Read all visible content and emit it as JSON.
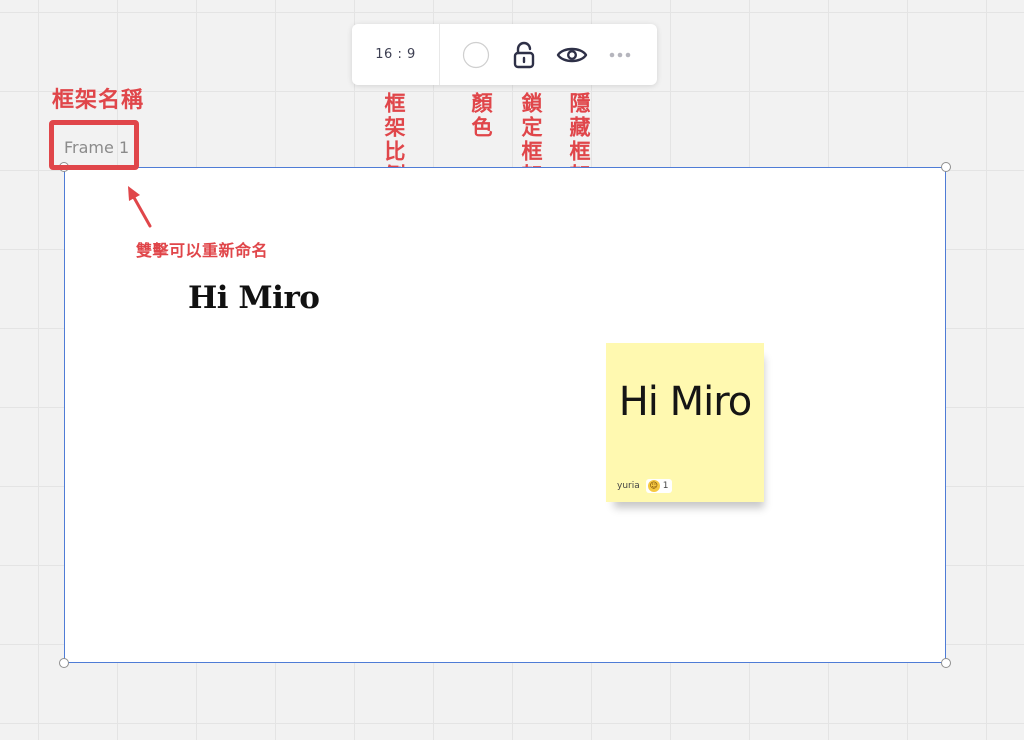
{
  "toolbar": {
    "aspect_ratio": "16 : 9",
    "icons": [
      "color-circle-icon",
      "unlock-icon",
      "eye-icon",
      "more-icon"
    ]
  },
  "annotations": {
    "frame_name": "框架名稱",
    "rename_hint": "雙擊可以重新命名",
    "frame_ratio": "框架比例",
    "color": "顏色",
    "lock_frame": "鎖定框架",
    "hide_content": "隱藏框架內容"
  },
  "frame": {
    "name": "Frame 1",
    "border_color": "#4f7cd6"
  },
  "canvas": {
    "title_text": "Hi Miro"
  },
  "sticky_note": {
    "text": "Hi Miro",
    "author": "yuria",
    "reaction_count": "1",
    "background": "#fff9b0"
  },
  "colors": {
    "annotation": "#e0464a",
    "canvas_background": "#f2f2f2"
  }
}
